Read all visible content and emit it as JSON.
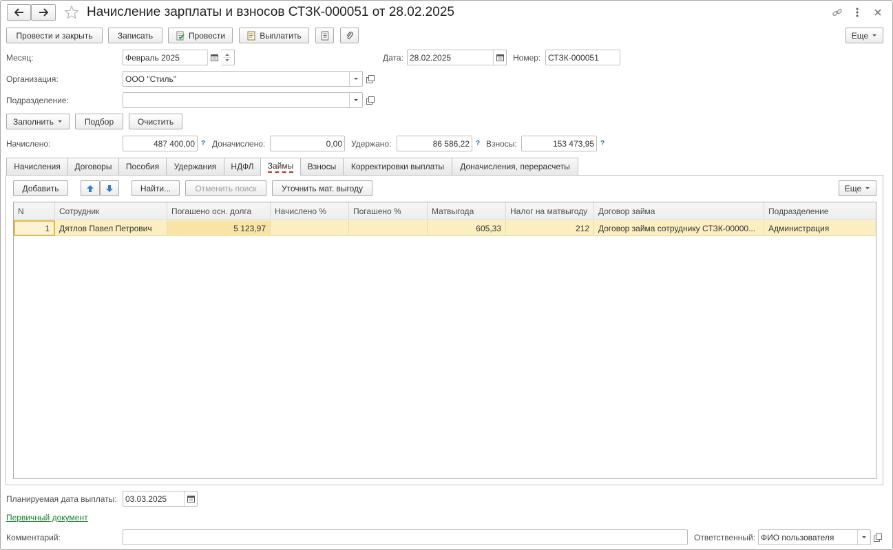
{
  "window": {
    "title": "Начисление зарплаты и взносов СТЗК-000051 от 28.02.2025"
  },
  "toolbar": {
    "post_close": "Провести и закрыть",
    "save": "Записать",
    "post": "Провести",
    "pay": "Выплатить",
    "more": "Еще"
  },
  "header": {
    "month_label": "Месяц:",
    "month_value": "Февраль 2025",
    "date_label": "Дата:",
    "date_value": "28.02.2025",
    "number_label": "Номер:",
    "number_value": "СТЗК-000051",
    "org_label": "Организация:",
    "org_value": "ООО \"Стиль\"",
    "dept_label": "Подразделение:",
    "dept_value": ""
  },
  "actions": {
    "fill": "Заполнить",
    "pick": "Подбор",
    "clear": "Очистить"
  },
  "totals": {
    "accrued_label": "Начислено:",
    "accrued_value": "487 400,00",
    "extra_label": "Доначислено:",
    "extra_value": "0,00",
    "withheld_label": "Удержано:",
    "withheld_value": "86 586,22",
    "contrib_label": "Взносы:",
    "contrib_value": "153 473,95",
    "help": "?"
  },
  "tabs": [
    "Начисления",
    "Договоры",
    "Пособия",
    "Удержания",
    "НДФЛ",
    "Займы",
    "Взносы",
    "Корректировки выплаты",
    "Доначисления, перерасчеты"
  ],
  "active_tab": "Займы",
  "table_toolbar": {
    "add": "Добавить",
    "find": "Найти...",
    "cancel_search": "Отменить поиск",
    "refine": "Уточнить мат. выгоду",
    "more": "Еще"
  },
  "table": {
    "columns": [
      "N",
      "Сотрудник",
      "Погашено осн. долга",
      "Начислено %",
      "Погашено %",
      "Матвыгода",
      "Налог на матвыгоду",
      "Договор займа",
      "Подразделение"
    ],
    "rows": [
      [
        "1",
        "Дятлов Павел Петрович",
        "5 123,97",
        "",
        "",
        "605,33",
        "212",
        "Договор займа сотруднику СТЗК-00000...",
        "Администрация"
      ]
    ]
  },
  "footer": {
    "pay_date_label": "Планируемая дата выплаты:",
    "pay_date_value": "03.03.2025",
    "primary_doc": "Первичный документ",
    "comment_label": "Комментарий:",
    "comment_value": "",
    "responsible_label": "Ответственный:",
    "responsible_value": "ФИО пользователя"
  },
  "colors": {
    "selected_row": "#fbeec1",
    "link": "#1a7d2f",
    "accent_blue": "#1a6fb5",
    "active_tab_underline": "#e02020"
  }
}
